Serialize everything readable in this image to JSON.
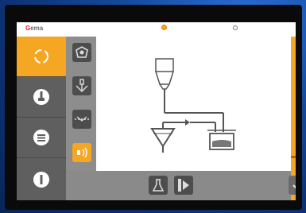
{
  "app": {
    "logo_text": "Gema"
  },
  "topbar": {
    "status_left_icon": "warning-circle-icon",
    "status_right_icon": "refresh-icon"
  },
  "sidebar": {
    "items": [
      {
        "icon": "cycle-icon",
        "active": true
      },
      {
        "icon": "spray-gun-icon",
        "active": false
      },
      {
        "icon": "list-icon",
        "active": false
      },
      {
        "icon": "info-icon",
        "active": false
      }
    ]
  },
  "subnav": {
    "items": [
      {
        "icon": "pump-icon",
        "active": false
      },
      {
        "icon": "injector-icon",
        "active": false
      },
      {
        "icon": "sieve-icon",
        "active": false
      },
      {
        "icon": "vibrator-icon",
        "active": true
      }
    ]
  },
  "diagram": {
    "icon": "powder-flow-diagram"
  },
  "bottombar": {
    "buttons": [
      {
        "icon": "flask-icon"
      },
      {
        "icon": "play-icon"
      },
      {
        "icon": "checkmark-icon"
      }
    ]
  },
  "colors": {
    "accent": "#f5a623",
    "sidebar": "#5f5f5f",
    "subnav": "#8d8d8d",
    "brand_red": "#e41e26"
  }
}
